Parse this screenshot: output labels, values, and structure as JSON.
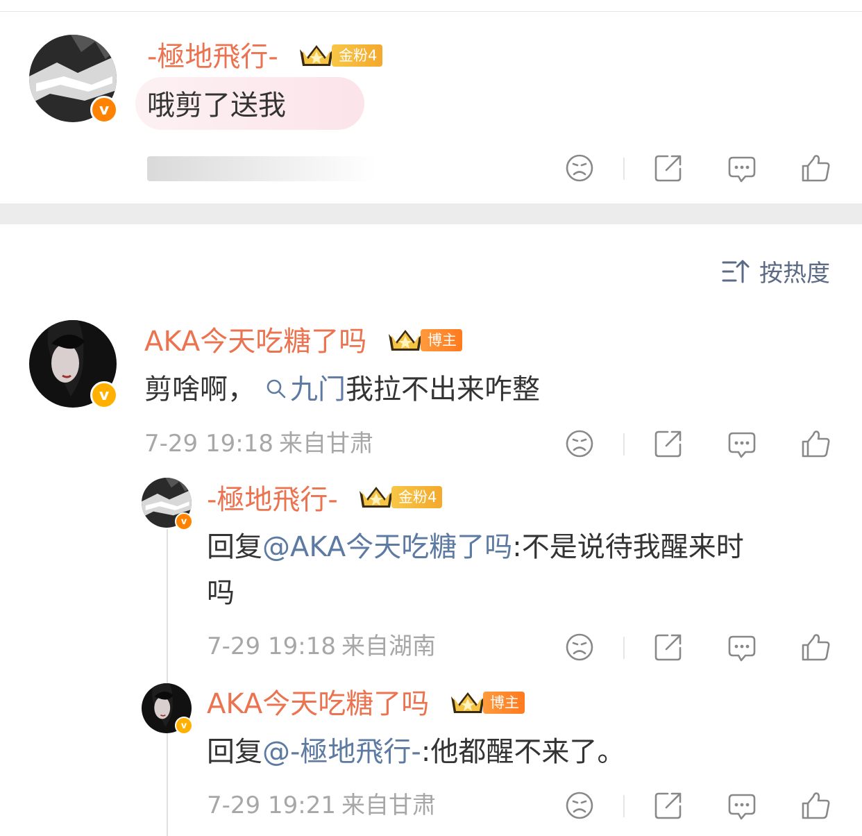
{
  "colors": {
    "username": "#eb7350",
    "link": "#5c7aa2",
    "meta": "#a7a7a7",
    "divider_band": "#ececec"
  },
  "top_comment": {
    "user": "-極地飛行-",
    "badge": "金粉4",
    "text": "哦剪了送我",
    "verified_icon": "v-badge-icon"
  },
  "sort": {
    "label": "按热度",
    "icon": "sort-icon"
  },
  "comments": [
    {
      "user": "AKA今天吃糖了吗",
      "badge": "博主",
      "text_before": "剪啥啊，",
      "topic": "九门",
      "text_after": "我拉不出来咋整",
      "time": "7-29 19:18",
      "location": "来自甘肃"
    },
    {
      "user": "-極地飛行-",
      "badge": "金粉4",
      "reply_prefix": "回复",
      "mention": "@AKA今天吃糖了吗",
      "text_line1": ":不是说待我醒来时",
      "text_line2": "吗",
      "time": "7-29 19:18",
      "location": "来自湖南"
    },
    {
      "user": "AKA今天吃糖了吗",
      "badge": "博主",
      "reply_prefix": "回复",
      "mention": "@-極地飛行-",
      "text": ":他都醒不来了。",
      "time": "7-29 19:21",
      "location": "来自甘肃"
    }
  ],
  "action_icons": [
    "dislike-icon",
    "share-icon",
    "comment-icon",
    "like-icon"
  ]
}
